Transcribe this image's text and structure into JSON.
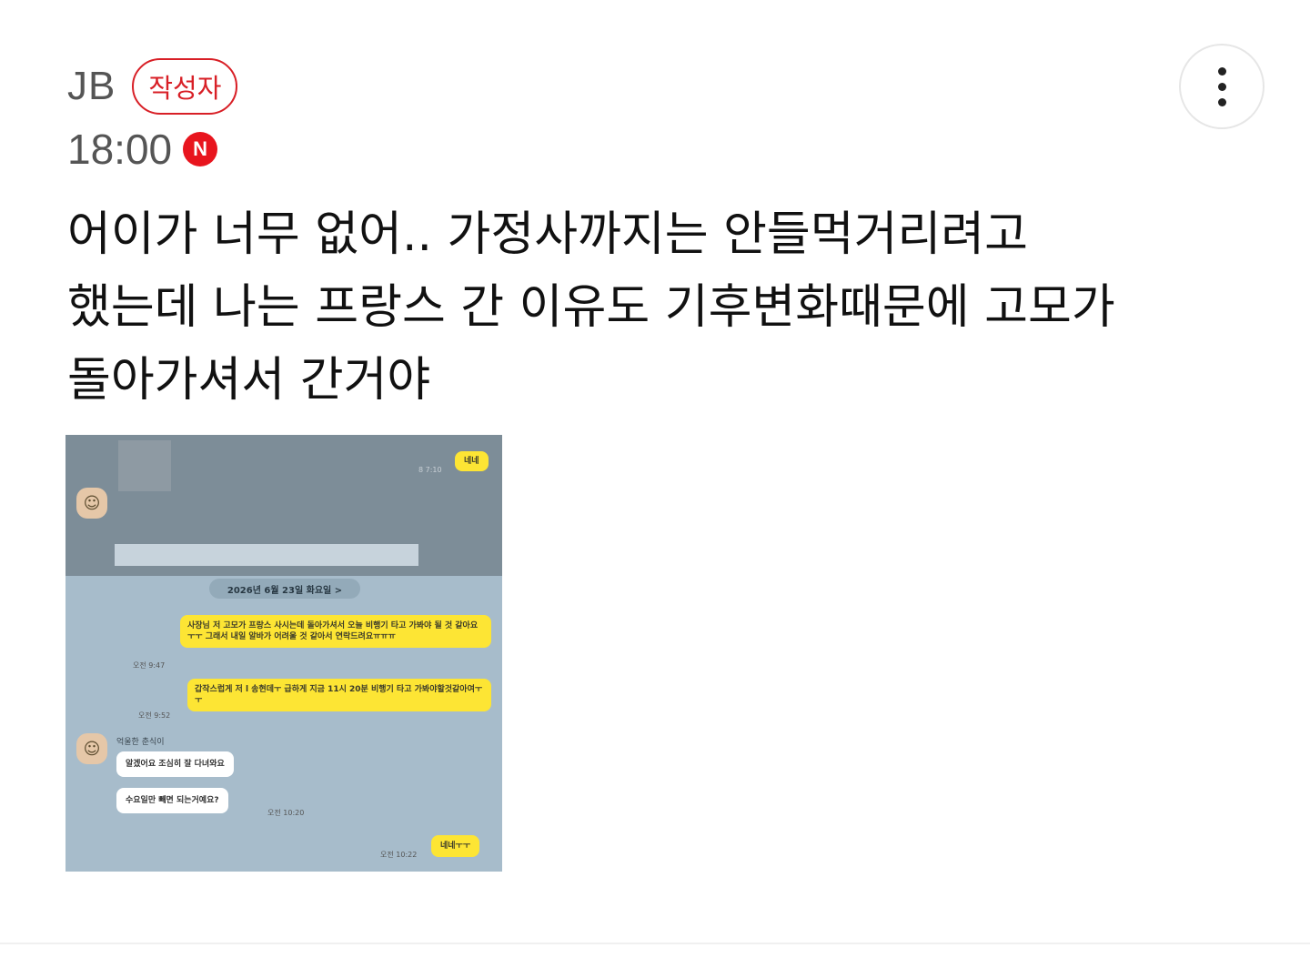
{
  "post": {
    "author": "JB",
    "author_badge": "작성자",
    "time": "18:00",
    "new_badge": "N",
    "lines": [
      "어이가 너무 없어.. 가정사까지는 안들먹거리려고",
      "했는데 나는 프랑스 간 이유도 기후변화때문에 고모가",
      "돌아가셔서 간거야"
    ]
  },
  "icons": {
    "more": "more-vertical-icon",
    "new": "new-badge-icon",
    "profile": "profile-avatar-icon"
  },
  "colors": {
    "badge_red": "#d81f26",
    "kakao_yellow": "#fde534",
    "chat_bg": "#a7bccb"
  },
  "chat_screenshot": {
    "top_message": "네네",
    "top_time": "8 7:10",
    "date_pill": "2026년 6월 23일 화요일 >",
    "messages": [
      {
        "text": "사장님 저 고모가 프랑스 사시는데 돌아가셔서 오늘 비행기 타고 가봐야 될 것 같아요ㅜㅜ 그래서 내일 알바가 어려울 것 같아서 연락드려요ㅠㅠㅠ",
        "time": "오전 9:47"
      },
      {
        "text": "갑작스럽게 저 l 송현데ㅜ 급하게 지금 11시 20분 비행기 타고 가봐야할것같아여ㅜㅜ",
        "time": "오전 9:52"
      }
    ],
    "sender_name": "억울한 춘식이",
    "replies": [
      {
        "text": "알겠어요 조심히 잘 다녀와요",
        "time": ""
      },
      {
        "text": "수요일만 빼면 되는거예요?",
        "time": "오전 10:20"
      }
    ],
    "last_message": "네네ㅜㅜ",
    "last_time": "오전 10:22"
  }
}
